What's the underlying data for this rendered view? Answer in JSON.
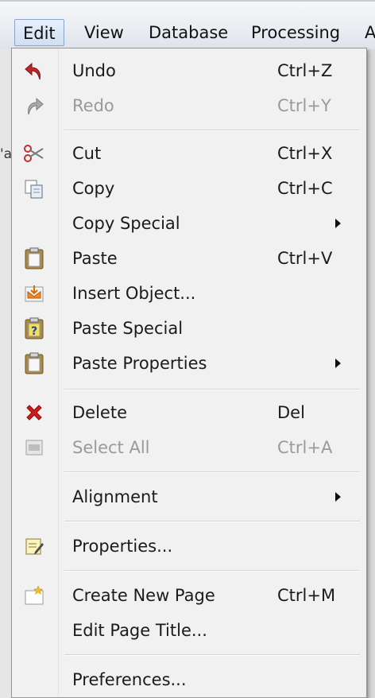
{
  "menubar": {
    "items": [
      "Edit",
      "View",
      "Database",
      "Processing",
      "A"
    ]
  },
  "background": {
    "left_fragment": "'a"
  },
  "edit_menu": {
    "items": [
      {
        "label": "Undo",
        "shortcut": "Ctrl+Z",
        "icon": "undo-icon"
      },
      {
        "label": "Redo",
        "shortcut": "Ctrl+Y",
        "icon": "redo-icon",
        "disabled": true
      },
      {
        "label": "Cut",
        "shortcut": "Ctrl+X",
        "icon": "scissors-icon"
      },
      {
        "label": "Copy",
        "shortcut": "Ctrl+C",
        "icon": "copy-icon"
      },
      {
        "label": "Copy Special",
        "shortcut": "",
        "submenu": true
      },
      {
        "label": "Paste",
        "shortcut": "Ctrl+V",
        "icon": "clipboard-icon"
      },
      {
        "label": "Insert Object...",
        "shortcut": "",
        "icon": "insert-object-icon"
      },
      {
        "label": "Paste Special",
        "shortcut": "",
        "icon": "paste-special-icon"
      },
      {
        "label": "Paste Properties",
        "shortcut": "",
        "icon": "paste-properties-icon",
        "submenu": true
      },
      {
        "label": "Delete",
        "shortcut": "Del",
        "icon": "delete-icon"
      },
      {
        "label": "Select All",
        "shortcut": "Ctrl+A",
        "icon": "select-all-icon",
        "disabled": true
      },
      {
        "label": "Alignment",
        "shortcut": "",
        "submenu": true
      },
      {
        "label": "Properties...",
        "shortcut": "",
        "icon": "properties-icon"
      },
      {
        "label": "Create New Page",
        "shortcut": "Ctrl+M",
        "icon": "new-page-icon"
      },
      {
        "label": "Edit Page Title...",
        "shortcut": ""
      },
      {
        "label": "Preferences...",
        "shortcut": ""
      }
    ]
  },
  "colors": {
    "undo": "#c0282a",
    "delete": "#d21b1b",
    "disabled_text": "#9a9a9a"
  }
}
